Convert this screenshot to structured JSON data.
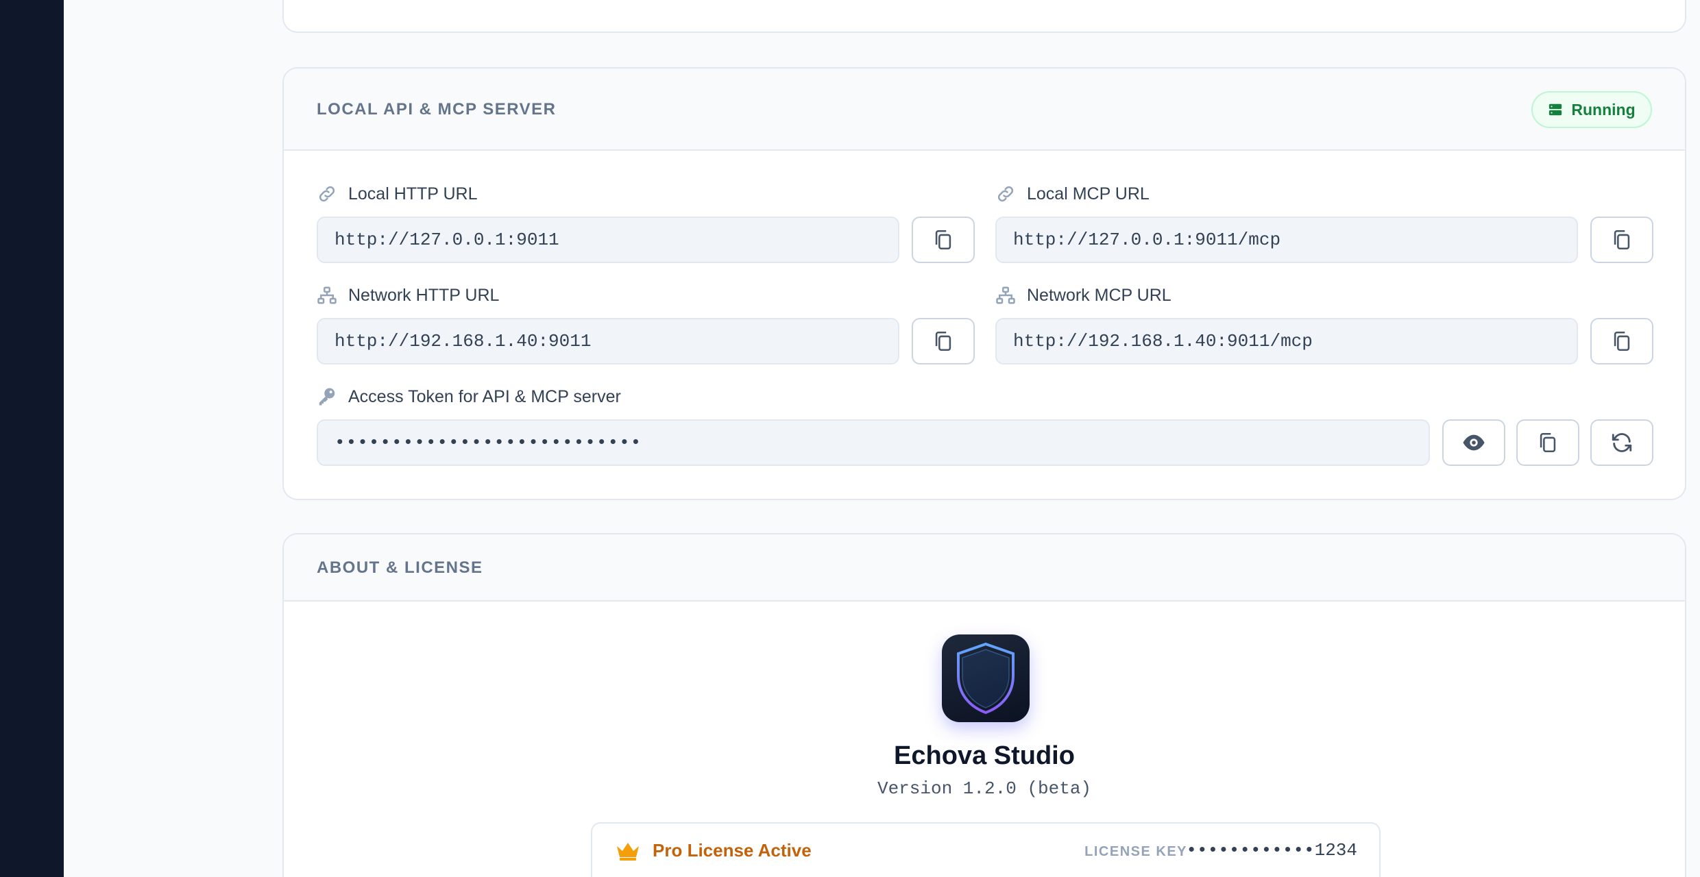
{
  "api_section": {
    "title": "LOCAL API & MCP SERVER",
    "status": "Running",
    "status_color": "#15803d",
    "local_http": {
      "label": "Local HTTP URL",
      "value": "http://127.0.0.1:9011",
      "icon": "link-icon"
    },
    "local_mcp": {
      "label": "Local MCP URL",
      "value": "http://127.0.0.1:9011/mcp",
      "icon": "link-icon"
    },
    "network_http": {
      "label": "Network HTTP URL",
      "value": "http://192.168.1.40:9011",
      "icon": "network-icon"
    },
    "network_mcp": {
      "label": "Network MCP URL",
      "value": "http://192.168.1.40:9011/mcp",
      "icon": "network-icon"
    },
    "access_token": {
      "label": "Access Token for API & MCP server",
      "value": "•••••••••••••••••••••••••••",
      "icon": "key-icon"
    },
    "button_icons": [
      "copy-icon",
      "eye-icon",
      "refresh-icon"
    ]
  },
  "about_section": {
    "title": "ABOUT & LICENSE",
    "app_name": "Echova Studio",
    "version": "Version 1.2.0 (beta)",
    "license": {
      "status": "Pro License Active",
      "status_color": "#c2620a",
      "key_label": "LICENSE KEY",
      "key_value": "••••••••••••1234",
      "icon": "crown-icon"
    }
  }
}
